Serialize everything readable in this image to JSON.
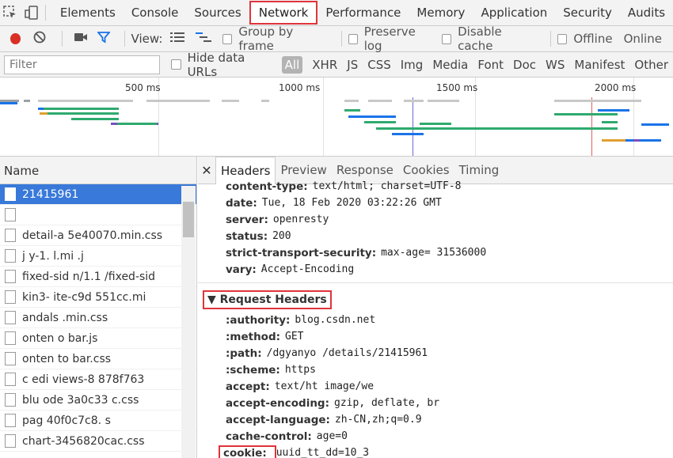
{
  "tabs": [
    "Elements",
    "Console",
    "Sources",
    "Network",
    "Performance",
    "Memory",
    "Application",
    "Security",
    "Audits"
  ],
  "active_tab": "Network",
  "toolbar": {
    "view_label": "View:",
    "group_by_frame": "Group by frame",
    "preserve_log": "Preserve log",
    "disable_cache": "Disable cache",
    "offline": "Offline",
    "online": "Online"
  },
  "filter": {
    "placeholder": "Filter",
    "hide_data_urls": "Hide data URLs",
    "types": [
      "All",
      "XHR",
      "JS",
      "CSS",
      "Img",
      "Media",
      "Font",
      "Doc",
      "WS",
      "Manifest",
      "Other"
    ]
  },
  "overview": {
    "ticks": [
      "500 ms",
      "1000 ms",
      "1500 ms",
      "2000 ms"
    ]
  },
  "requests": {
    "header": "Name",
    "items": [
      "21415961",
      "",
      "detail-a  5e40070.min.css",
      "j     y-1.  l.mi  .j",
      "  fixed-sid    n/1.1   /fixed-sid",
      "  kin3-   ite-c9d   551cc.mi",
      "  andals    .min.css",
      "  onten    o   bar.js",
      "  onten     to    bar.css",
      "  c   edi   views-8    878f763",
      "  blu   ode    3a0c33     c.css",
      "  pag     40f0c7c8.  s",
      "chart-3456820cac.css"
    ]
  },
  "detail": {
    "tabs": [
      "Headers",
      "Preview",
      "Response",
      "Cookies",
      "Timing"
    ],
    "response_headers": [
      {
        "k": "content-type:",
        "v": "text/html; charset=UTF-8"
      },
      {
        "k": "date:",
        "v": "Tue, 18 Feb 2020 03:22:26 GMT"
      },
      {
        "k": "server:",
        "v": "openresty"
      },
      {
        "k": "status:",
        "v": "200"
      },
      {
        "k": "strict-transport-security:",
        "v": "max-age= 31536000"
      },
      {
        "k": "vary:",
        "v": "Accept-Encoding"
      }
    ],
    "request_section": "Request Headers",
    "request_headers": [
      {
        "k": ":authority:",
        "v": "blog.csdn.net"
      },
      {
        "k": ":method:",
        "v": "GET"
      },
      {
        "k": ":path:",
        "v": "/dgyanyo        /details/21415961"
      },
      {
        "k": ":scheme:",
        "v": "https"
      },
      {
        "k": "accept:",
        "v": "text/ht                                        image/we"
      },
      {
        "k": "accept-encoding:",
        "v": "gzip, deflate, br"
      },
      {
        "k": "accept-language:",
        "v": "zh-CN,zh;q=0.9"
      },
      {
        "k": "cache-control:",
        "v": "     age=0"
      },
      {
        "k": "cookie:",
        "v": "uuid_tt_dd=10_3"
      }
    ]
  },
  "colors": {
    "accent": "#e0343a",
    "selected": "#3879d9",
    "record": "#d93025",
    "filter_icon": "#1a73e8"
  }
}
